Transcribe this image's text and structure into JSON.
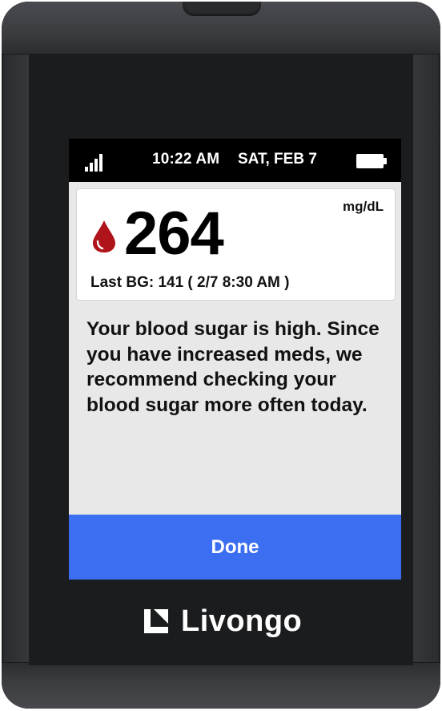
{
  "status_bar": {
    "signal_icon": "cellular-signal-icon",
    "time": "10:22 AM",
    "date": "SAT, FEB 7",
    "battery_icon": "battery-full-icon"
  },
  "reading": {
    "icon": "blood-drop-icon",
    "value": "264",
    "unit": "mg/dL",
    "last_bg": "Last BG: 141 ( 2/7 8:30 AM )"
  },
  "message": "Your blood sugar is high. Since you have increased meds, we recommend checking your blood sugar more often today.",
  "done_button": {
    "label": "Done"
  },
  "brand": {
    "name": "Livongo"
  },
  "colors": {
    "accent": "#3b6ef0",
    "drop": "#b0141b",
    "status_bar": "#000000",
    "screen_bg": "#e8e8e8"
  }
}
